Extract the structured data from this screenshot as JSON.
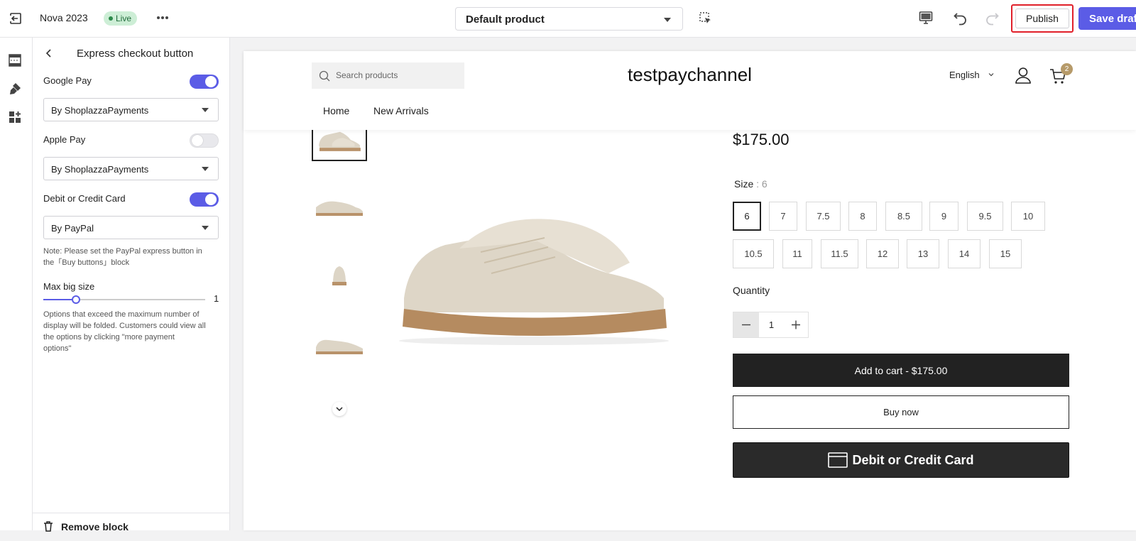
{
  "topbar": {
    "store_name": "Nova 2023",
    "status_badge": "Live",
    "page_select_value": "Default product",
    "publish_label": "Publish",
    "save_draft_label": "Save draft"
  },
  "panel": {
    "title": "Express checkout button",
    "google_pay": {
      "label": "Google Pay",
      "enabled": true,
      "provider": "By ShoplazzaPayments"
    },
    "apple_pay": {
      "label": "Apple Pay",
      "enabled": false,
      "provider": "By ShoplazzaPayments"
    },
    "debit_card": {
      "label": "Debit or Credit Card",
      "enabled": true,
      "provider": "By PayPal"
    },
    "note_line1": "Note: Please set the PayPal express button in",
    "note_line2": "the「Buy buttons」block",
    "max_big_size": {
      "label": "Max big size",
      "value": "1",
      "fraction": 0.2
    },
    "help_line1": "Options that exceed the maximum number of",
    "help_line2": "display will be folded. Customers could view all",
    "help_line3": "the options by clicking \"more payment",
    "help_line4": "options\"",
    "remove_block_label": "Remove block"
  },
  "store": {
    "search_placeholder": "Search products",
    "brand": "testpaychannel",
    "language": "English",
    "cart_count": "2",
    "nav": [
      "Home",
      "New Arrivals"
    ]
  },
  "product": {
    "price": "$175.00",
    "size_label": "Size",
    "size_selected": ": 6",
    "sizes_row1": [
      "6",
      "7",
      "7.5",
      "8",
      "8.5",
      "9",
      "9.5",
      "10"
    ],
    "sizes_row2": [
      "10.5",
      "11",
      "11.5",
      "12",
      "13",
      "14",
      "15"
    ],
    "quantity_label": "Quantity",
    "quantity_value": "1",
    "add_to_cart_label": "Add to cart  -  $175.00",
    "buy_now_label": "Buy now",
    "card_button_label": "Debit or Credit Card"
  },
  "colors": {
    "accent": "#5b5ce6",
    "live_badge_bg": "#cdeed6",
    "publish_outline": "#e0202a",
    "cart_badge": "#b69a69"
  },
  "icons": [
    "exit-icon",
    "more-icon",
    "select-element-icon",
    "desktop-icon",
    "undo-icon",
    "redo-icon",
    "sections-icon",
    "theme-style-icon",
    "apps-icon",
    "back-icon",
    "search-icon",
    "user-icon",
    "cart-icon",
    "chevron-down-icon",
    "minus-icon",
    "plus-icon",
    "card-icon",
    "trash-icon"
  ]
}
